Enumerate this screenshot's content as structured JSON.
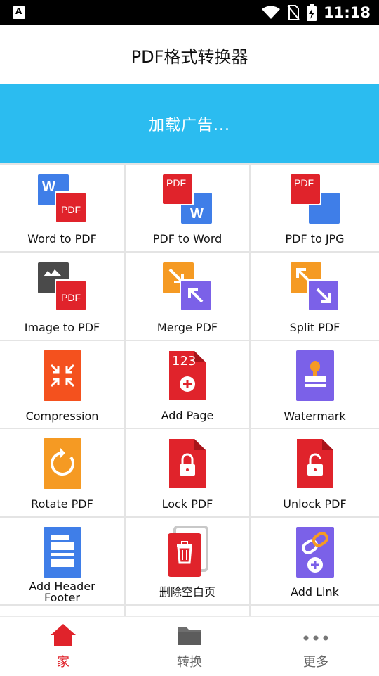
{
  "status_bar": {
    "time": "11:18"
  },
  "header": {
    "title": "PDF格式转换器"
  },
  "ad": {
    "text": "加载广告..."
  },
  "tools": [
    {
      "label": "Word to PDF",
      "icon": "word-to-pdf-icon"
    },
    {
      "label": "PDF to Word",
      "icon": "pdf-to-word-icon"
    },
    {
      "label": "PDF to JPG",
      "icon": "pdf-to-jpg-icon"
    },
    {
      "label": "Image to PDF",
      "icon": "image-to-pdf-icon"
    },
    {
      "label": "Merge PDF",
      "icon": "merge-pdf-icon"
    },
    {
      "label": "Split PDF",
      "icon": "split-pdf-icon"
    },
    {
      "label": "Compression",
      "icon": "compression-icon"
    },
    {
      "label": "Add Page",
      "icon": "add-page-icon"
    },
    {
      "label": "Watermark",
      "icon": "watermark-icon"
    },
    {
      "label": "Rotate PDF",
      "icon": "rotate-pdf-icon"
    },
    {
      "label": "Lock PDF",
      "icon": "lock-pdf-icon"
    },
    {
      "label": "Unlock PDF",
      "icon": "unlock-pdf-icon"
    },
    {
      "label_line1": "Add Header",
      "label_line2": "Footer",
      "icon": "add-header-footer-icon"
    },
    {
      "label": "删除空白页",
      "icon": "delete-blank-page-icon"
    },
    {
      "label": "Add Link",
      "icon": "add-link-icon"
    }
  ],
  "icon_badges": {
    "pdf": "PDF",
    "word": "W",
    "page_numbers": "123"
  },
  "bottom_nav": [
    {
      "label": "家",
      "icon": "home-icon",
      "active": true
    },
    {
      "label": "转换",
      "icon": "folder-icon",
      "active": false
    },
    {
      "label": "更多",
      "icon": "more-dots-icon",
      "active": false
    }
  ],
  "colors": {
    "accent_red": "#e0232b",
    "ad_blue": "#2bbcf0",
    "word_blue": "#3f7ee8",
    "orange": "#f59a23",
    "purple": "#7b61e8",
    "compress_orange": "#f4511e",
    "nav_inactive": "#666666"
  }
}
